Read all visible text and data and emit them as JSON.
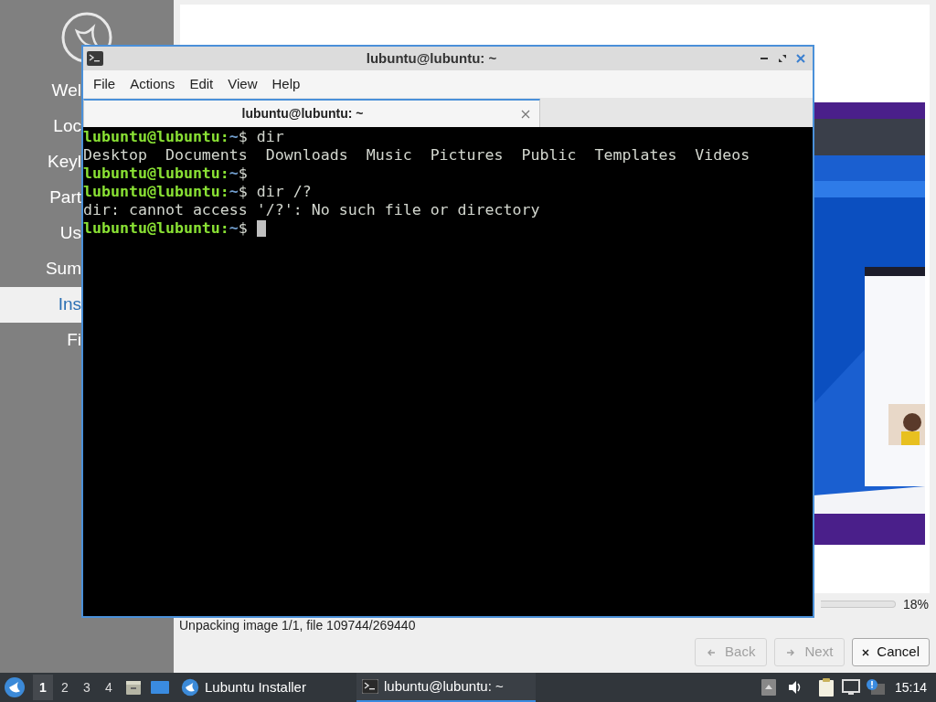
{
  "installer": {
    "sidebar": {
      "items": [
        {
          "label": "Wel",
          "selected": false
        },
        {
          "label": "Loc",
          "selected": false
        },
        {
          "label": "Keyl",
          "selected": false
        },
        {
          "label": "Part",
          "selected": false
        },
        {
          "label": "Us",
          "selected": false
        },
        {
          "label": "Sum",
          "selected": false
        },
        {
          "label": "Ins",
          "selected": true
        },
        {
          "label": "Fi",
          "selected": false
        }
      ]
    },
    "progress": {
      "reading": "18%"
    },
    "status": "Unpacking image 1/1, file 109744/269440",
    "buttons": [
      {
        "label": "Back",
        "disabled": true
      },
      {
        "label": "Next",
        "disabled": true
      },
      {
        "label": "Cancel",
        "disabled": false
      }
    ]
  },
  "terminal": {
    "window": {
      "title": "lubuntu@lubuntu: ~"
    },
    "menu": [
      "File",
      "Actions",
      "Edit",
      "View",
      "Help"
    ],
    "tabs": [
      {
        "label": "lubuntu@lubuntu: ~",
        "selected": true
      }
    ],
    "lines": [
      {
        "kind": "prompt",
        "user": "lubuntu@lubuntu:",
        "path": "~",
        "sign": "$",
        "command": "dir"
      },
      {
        "kind": "output",
        "text": "Desktop  Documents  Downloads  Music  Pictures  Public  Templates  Videos"
      },
      {
        "kind": "prompt",
        "user": "lubuntu@lubuntu:",
        "path": "~",
        "sign": "$"
      },
      {
        "kind": "prompt",
        "user": "lubuntu@lubuntu:",
        "path": "~",
        "sign": "$",
        "command": "dir /?"
      },
      {
        "kind": "output",
        "text": "dir: cannot access '/?': No such file or directory"
      },
      {
        "kind": "prompt",
        "user": "lubuntu@lubuntu:",
        "path": "~",
        "sign": "$",
        "cursor": true
      }
    ]
  },
  "taskbar": {
    "workspaces": [
      {
        "label": "1",
        "selected": true
      },
      {
        "label": "2",
        "selected": false
      },
      {
        "label": "3",
        "selected": false
      },
      {
        "label": "4",
        "selected": false
      }
    ],
    "tasks": [
      {
        "label": "Lubuntu Installer",
        "selected": false
      },
      {
        "label": "lubuntu@lubuntu: ~",
        "selected": true
      }
    ],
    "clock": "15:14"
  }
}
